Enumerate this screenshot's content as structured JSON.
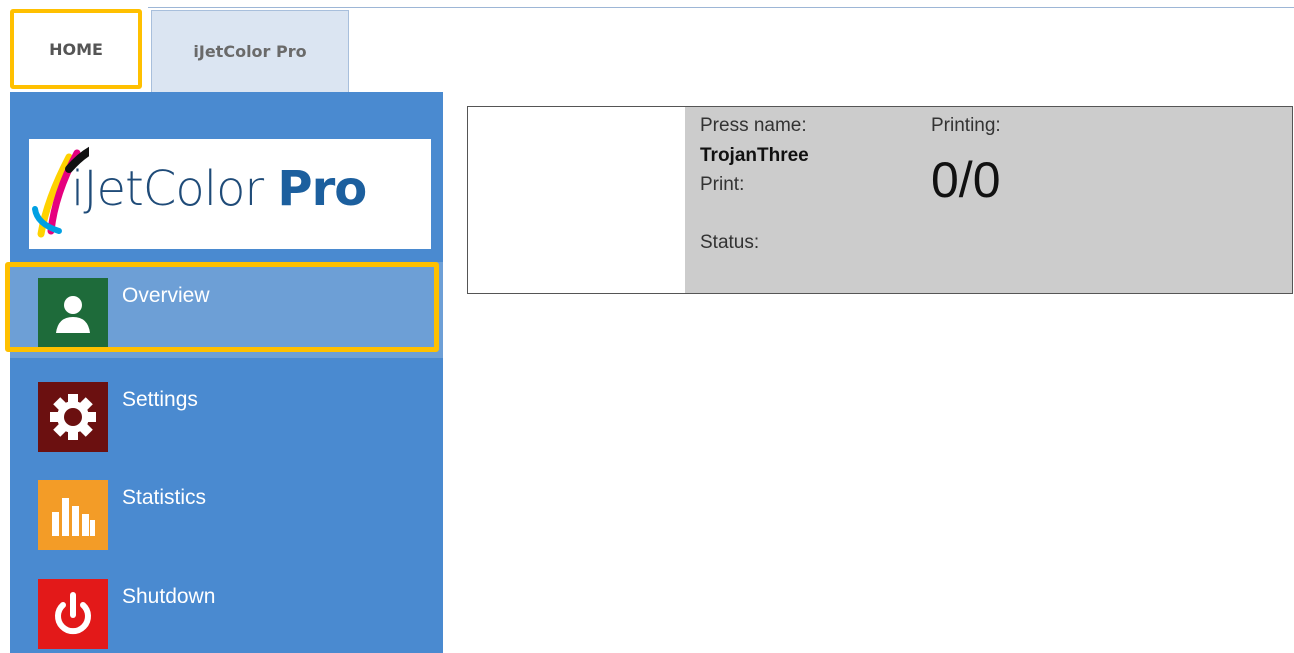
{
  "tabs": [
    {
      "label": "HOME"
    },
    {
      "label": "iJetColor Pro"
    }
  ],
  "logo": {
    "text_main": "iJetColor ",
    "text_pro": "Pro"
  },
  "sidebar": {
    "items": [
      {
        "label": "Overview",
        "icon": "user-icon"
      },
      {
        "label": "Settings",
        "icon": "gear-icon"
      },
      {
        "label": "Statistics",
        "icon": "bar-chart-icon"
      },
      {
        "label": "Shutdown",
        "icon": "power-icon"
      }
    ]
  },
  "press": {
    "press_name_label": "Press name:",
    "press_name_value": "TrojanThree",
    "print_label": "Print:",
    "status_label": "Status:",
    "printing_label": "Printing:",
    "printing_value": "0/0"
  },
  "colors": {
    "sidebar": "#4a8ad0",
    "highlight": "#ffc000",
    "overview_icon_bg": "#1e6b3a",
    "settings_icon_bg": "#6b1010",
    "statistics_icon_bg": "#f39c27",
    "shutdown_icon_bg": "#e31919"
  }
}
